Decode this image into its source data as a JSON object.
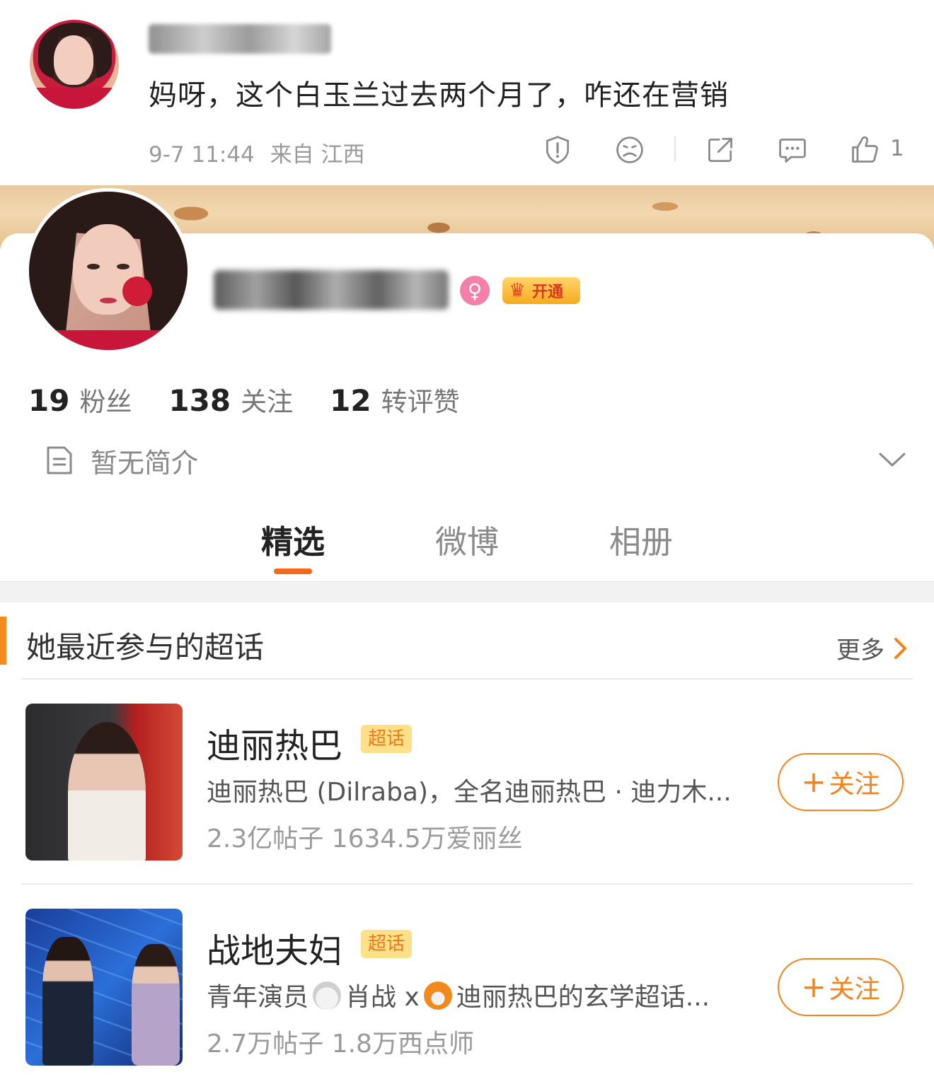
{
  "comment": {
    "text": "妈呀，这个白玉兰过去两个月了，咋还在营销",
    "time": "9-7 11:44",
    "source": "来自 江西",
    "like_count": "1",
    "icons": [
      "report-icon",
      "sad-face-icon",
      "share-icon",
      "comment-icon",
      "like-icon"
    ]
  },
  "profile": {
    "vip_label": "开通",
    "stats": [
      {
        "num": "19",
        "label": "粉丝"
      },
      {
        "num": "138",
        "label": "关注"
      },
      {
        "num": "12",
        "label": "转评赞"
      }
    ],
    "bio": "暂无简介",
    "tabs": [
      "精选",
      "微博",
      "相册"
    ],
    "active_tab": "精选"
  },
  "section": {
    "title": "她最近参与的超话",
    "more": "更多"
  },
  "topics": [
    {
      "name": "迪丽热巴",
      "tag": "超话",
      "desc": "迪丽热巴 (Dilraba)，全名迪丽热巴 · 迪力木...",
      "stats": "2.3亿帖子 1634.5万爱丽丝",
      "follow": "关注"
    },
    {
      "name": "战地夫妇",
      "tag": "超话",
      "desc_a": "青年演员",
      "desc_b": "肖战 x",
      "desc_c": "迪丽热巴的玄学超话...",
      "stats": "2.7万帖子 1.8万西点师",
      "follow": "关注"
    }
  ]
}
